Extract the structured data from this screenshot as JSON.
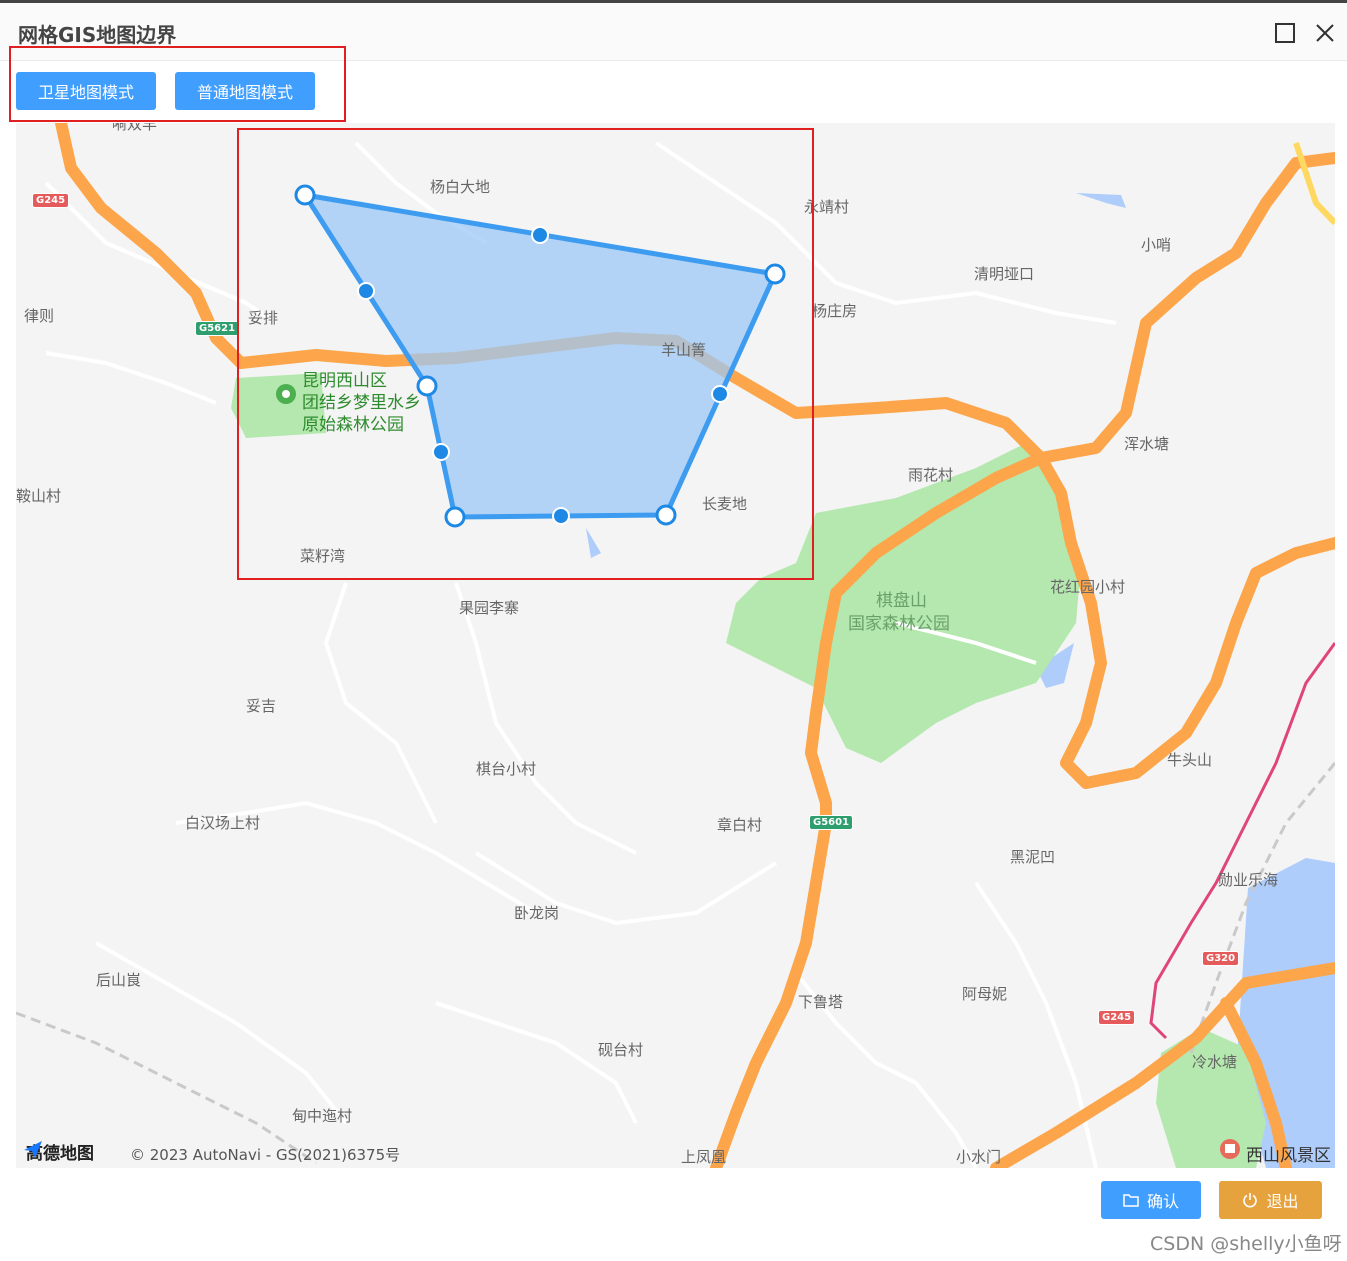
{
  "window": {
    "title": "网格GIS地图边界"
  },
  "toolbar": {
    "satellite_label": "卫星地图模式",
    "normal_label": "普通地图模式"
  },
  "map": {
    "places": {
      "yangbai": "杨白大地",
      "yongjing": "永靖村",
      "xiaoshao": "小哨",
      "qingming": "清明垭口",
      "yangzhuang": "杨庄房",
      "lvze": "律则",
      "tuopai": "妥排",
      "yangshan": "羊山箐",
      "park1": "昆明西山区",
      "park2": "团结乡梦里水乡",
      "park3": "原始森林公园",
      "hunshui": "浑水塘",
      "anshan": "鞍山村",
      "yuhua": "雨花村",
      "changmai": "长麦地",
      "caizi": "菜籽湾",
      "guoyuan": "果园李寨",
      "qipan1": "棋盘山",
      "qipan2": "国家森林公园",
      "huahong": "花红园小村",
      "tuoji": "妥吉",
      "qitai": "棋台小村",
      "niutou": "牛头山",
      "baihan": "白汉场上村",
      "zhangbai": "章白村",
      "heini": "黑泥凹",
      "lijiang": "勋业乐海",
      "wolong": "卧龙岗",
      "houshan": "后山峎",
      "xialu": "下鲁塔",
      "amu": "阿母妮",
      "yantai": "砚台村",
      "lengshui": "冷水塘",
      "dianzhong": "甸中迤村",
      "shangfeng": "上凤凰",
      "xiaoshuimen": "小水门",
      "xishan": "西山风景区",
      "top_cut": "嗬双羊"
    },
    "shields": {
      "g245a": "G245",
      "g5621": "G5621",
      "g5601": "G5601",
      "g320": "G320",
      "g245b": "G245"
    },
    "logo_text": "高德地图",
    "copyright": "© 2023 AutoNavi - GS(2021)6375号",
    "colors": {
      "highway": "#fca54a",
      "park": "#b4e8ae",
      "water": "#aecdfb",
      "polygon_fill": "#9cc8f5",
      "polygon_stroke": "#3d9cf0"
    }
  },
  "footer": {
    "confirm_label": "确认",
    "exit_label": "退出"
  },
  "watermark": "CSDN @shelly小鱼呀",
  "colors": {
    "primary": "#409eff",
    "warning": "#e6a23c",
    "annotation": "#e02020"
  }
}
